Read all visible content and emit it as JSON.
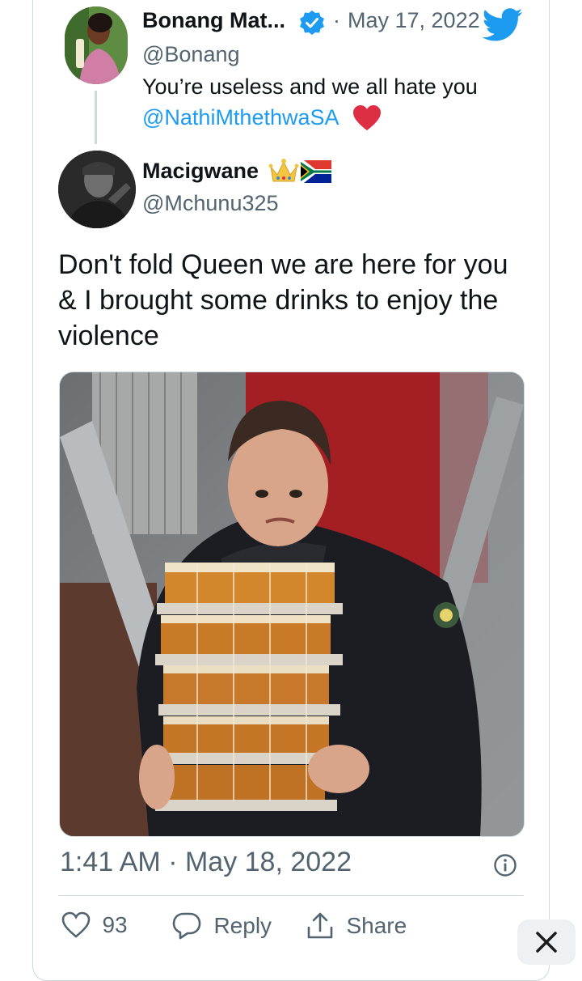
{
  "quoted_tweet": {
    "name": "Bonang Mat...",
    "separator": "·",
    "date": "May 17, 2022",
    "handle": "@Bonang",
    "text": "You’re useless and we all hate you",
    "mention": "@NathiMthethwaSA",
    "avatar_icon": "profile-photo",
    "verified_icon": "verified-badge-icon",
    "emoji": "red-heart"
  },
  "tweet": {
    "name": "Macigwane",
    "handle": "@Mchunu325",
    "emojis": [
      "crown",
      "south-africa-flag"
    ],
    "body": "Don't fold Queen we are here for you & I brought some drinks to enjoy the violence",
    "photo_icon": "man-carrying-beer-cups-photo",
    "timestamp": "1:41 AM · May 18, 2022"
  },
  "actions": {
    "like_count": "93",
    "reply_label": "Reply",
    "share_label": "Share"
  },
  "colors": {
    "text": "#0f1419",
    "secondary": "#536471",
    "accent": "#1d9bf0",
    "border": "#cfd9de",
    "heart": "#e0245e"
  }
}
